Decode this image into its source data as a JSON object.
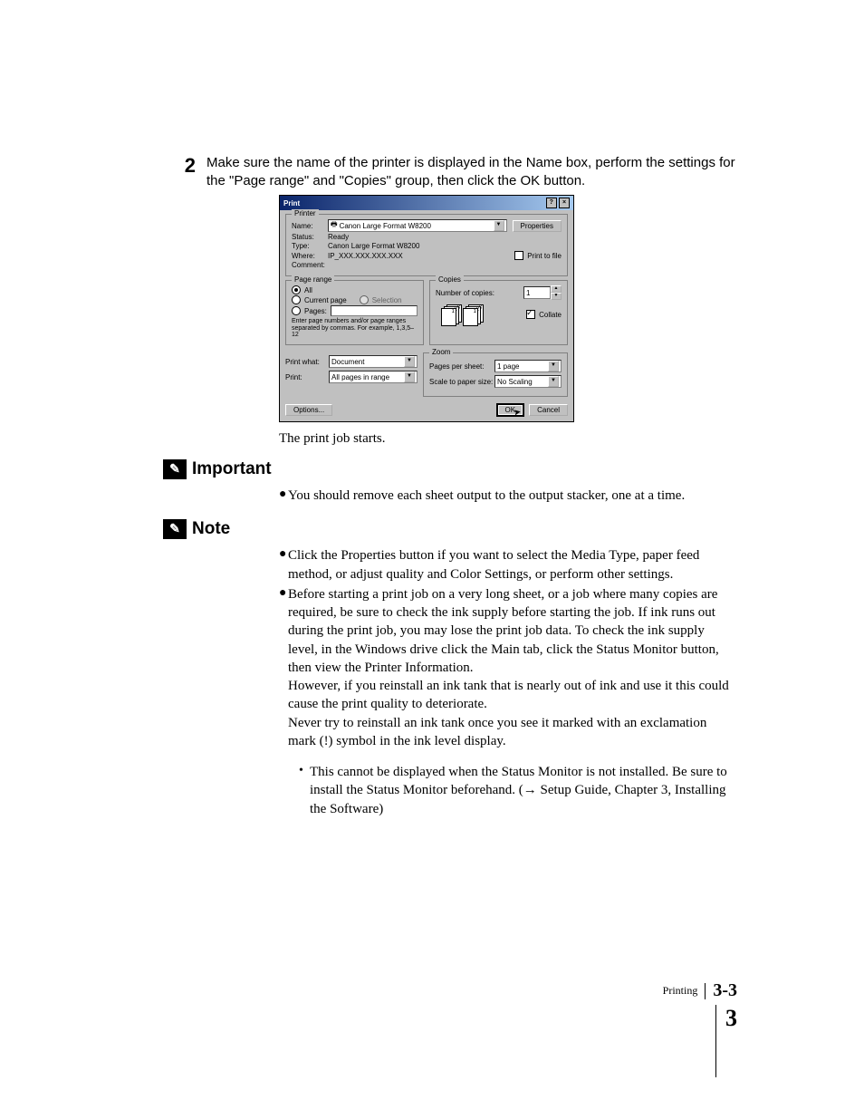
{
  "step": {
    "number": "2",
    "text": "Make sure the name of the printer is displayed in the Name box, perform the settings for the \"Page range\" and \"Copies\" group, then click the OK button."
  },
  "dialog": {
    "title": "Print",
    "printer_legend": "Printer",
    "name_label": "Name:",
    "name_value": "Canon Large Format W8200",
    "properties_btn": "Properties",
    "status_label": "Status:",
    "status_value": "Ready",
    "type_label": "Type:",
    "type_value": "Canon Large Format W8200",
    "where_label": "Where:",
    "where_value": "IP_XXX.XXX.XXX.XXX",
    "comment_label": "Comment:",
    "print_to_file": "Print to file",
    "page_range_legend": "Page range",
    "all": "All",
    "current_page": "Current page",
    "selection": "Selection",
    "pages": "Pages:",
    "pages_hint": "Enter page numbers and/or page ranges separated by commas. For example, 1,3,5–12",
    "copies_legend": "Copies",
    "num_copies_label": "Number of copies:",
    "num_copies_value": "1",
    "collate": "Collate",
    "print_what_label": "Print what:",
    "print_what_value": "Document",
    "print_label": "Print:",
    "print_value": "All pages in range",
    "zoom_legend": "Zoom",
    "pps_label": "Pages per sheet:",
    "pps_value": "1 page",
    "scale_label": "Scale to paper size:",
    "scale_value": "No Scaling",
    "options_btn": "Options...",
    "ok_btn": "OK",
    "cancel_btn": "Cancel"
  },
  "after_dialog": "The print job starts.",
  "important": {
    "title": "Important",
    "items": [
      "You should remove each sheet output to the output stacker, one at a time."
    ]
  },
  "note": {
    "title": "Note",
    "items": [
      "Click the Properties button if you want to select the Media Type, paper feed method, or adjust quality and Color Settings, or perform other settings.",
      {
        "intro": "Before starting a print job on a very long sheet, or a job where many copies are required, be sure to check the ink supply before starting the job. If ink runs out during the print job, you may lose the print job data. To check the ink supply level, in the Windows drive click the Main tab, click the Status Monitor button, then view the Printer Information.",
        "p2": "However, if you reinstall an ink tank that is nearly out of ink and use it this could cause the print quality to deteriorate.",
        "p3": "Never try to reinstall an ink tank once you see it marked with an exclamation mark (!) symbol in the ink level display.",
        "sub": "This cannot be displayed when the Status Monitor is not installed. Be sure to install the Status Monitor beforehand. (→ Setup Guide, Chapter 3, Installing the Software)"
      }
    ]
  },
  "footer": {
    "section": "Printing",
    "page": "3-3",
    "chapter": "3"
  }
}
